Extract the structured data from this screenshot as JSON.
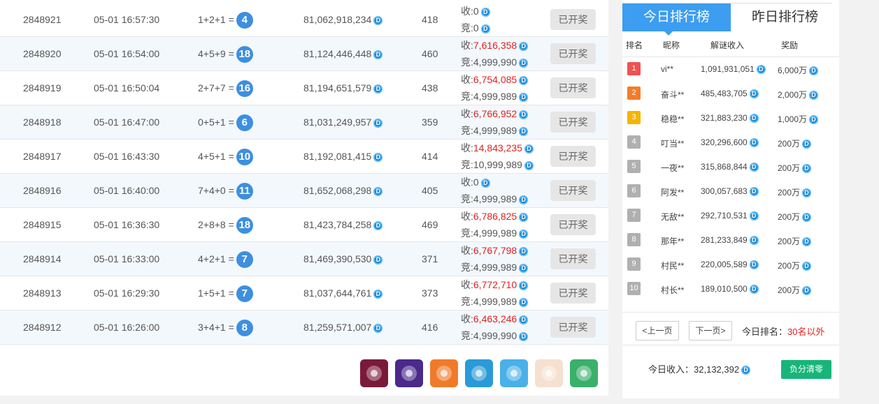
{
  "rows": [
    {
      "id": "2848921",
      "time": "05-01 16:57:30",
      "formula": "1+2+1 =",
      "sum": "4",
      "pool": "81,062,918,234",
      "count": "418",
      "income_label": "收:",
      "income": "0",
      "income_red": false,
      "bet_label": "竞:",
      "bet": "0",
      "status": "已开奖"
    },
    {
      "id": "2848920",
      "time": "05-01 16:54:00",
      "formula": "4+5+9 =",
      "sum": "18",
      "pool": "81,124,446,448",
      "count": "460",
      "income_label": "收:",
      "income": "7,616,358",
      "income_red": true,
      "bet_label": "竞:",
      "bet": "4,999,990",
      "status": "已开奖"
    },
    {
      "id": "2848919",
      "time": "05-01 16:50:04",
      "formula": "2+7+7 =",
      "sum": "16",
      "pool": "81,194,651,579",
      "count": "438",
      "income_label": "收:",
      "income": "6,754,085",
      "income_red": true,
      "bet_label": "竞:",
      "bet": "4,999,989",
      "status": "已开奖"
    },
    {
      "id": "2848918",
      "time": "05-01 16:47:00",
      "formula": "0+5+1 =",
      "sum": "6",
      "pool": "81,031,249,957",
      "count": "359",
      "income_label": "收:",
      "income": "6,766,952",
      "income_red": true,
      "bet_label": "竞:",
      "bet": "4,999,989",
      "status": "已开奖"
    },
    {
      "id": "2848917",
      "time": "05-01 16:43:30",
      "formula": "4+5+1 =",
      "sum": "10",
      "pool": "81,192,081,415",
      "count": "414",
      "income_label": "收:",
      "income": "14,843,235",
      "income_red": true,
      "bet_label": "竞:",
      "bet": "10,999,989",
      "status": "已开奖"
    },
    {
      "id": "2848916",
      "time": "05-01 16:40:00",
      "formula": "7+4+0 =",
      "sum": "11",
      "pool": "81,652,068,298",
      "count": "405",
      "income_label": "收:",
      "income": "0",
      "income_red": false,
      "bet_label": "竞:",
      "bet": "4,999,989",
      "status": "已开奖"
    },
    {
      "id": "2848915",
      "time": "05-01 16:36:30",
      "formula": "2+8+8 =",
      "sum": "18",
      "pool": "81,423,784,258",
      "count": "469",
      "income_label": "收:",
      "income": "6,786,825",
      "income_red": true,
      "bet_label": "竞:",
      "bet": "4,999,989",
      "status": "已开奖"
    },
    {
      "id": "2848914",
      "time": "05-01 16:33:00",
      "formula": "4+2+1 =",
      "sum": "7",
      "pool": "81,469,390,530",
      "count": "371",
      "income_label": "收:",
      "income": "6,767,798",
      "income_red": true,
      "bet_label": "竞:",
      "bet": "4,999,989",
      "status": "已开奖"
    },
    {
      "id": "2848913",
      "time": "05-01 16:29:30",
      "formula": "1+5+1 =",
      "sum": "7",
      "pool": "81,037,644,761",
      "count": "373",
      "income_label": "收:",
      "income": "6,772,710",
      "income_red": true,
      "bet_label": "竞:",
      "bet": "4,999,989",
      "status": "已开奖"
    },
    {
      "id": "2848912",
      "time": "05-01 16:26:00",
      "formula": "3+4+1 =",
      "sum": "8",
      "pool": "81,259,571,007",
      "count": "416",
      "income_label": "收:",
      "income": "6,463,246",
      "income_red": true,
      "bet_label": "竞:",
      "bet": "4,999,990",
      "status": "已开奖"
    }
  ],
  "coin_glyph": "D",
  "games": [
    {
      "name": "ufo-game-icon",
      "color": "#7a1a3a"
    },
    {
      "name": "rocket-game-icon",
      "color": "#4a2a8a"
    },
    {
      "name": "dragon-game-icon",
      "color": "#f07a2a"
    },
    {
      "name": "boat-game-icon",
      "color": "#2a9ad8"
    },
    {
      "name": "taxi-game-icon",
      "color": "#4ab0e8"
    },
    {
      "name": "scooter-game-icon",
      "color": "#f6e0d0"
    },
    {
      "name": "bicycle-game-icon",
      "color": "#3ab06a"
    }
  ],
  "sidebar": {
    "tab_today": "今日排行榜",
    "tab_yesterday": "昨日排行榜",
    "head_rank": "排名",
    "head_nick": "昵称",
    "head_income": "解谜收入",
    "head_reward": "奖励",
    "ranking": [
      {
        "rank": "1",
        "nick": "vi**",
        "income": "1,091,931,051",
        "reward": "6,000万",
        "color": "#ef5350"
      },
      {
        "rank": "2",
        "nick": "奋斗**",
        "income": "485,483,705",
        "reward": "2,000万",
        "color": "#f57c28"
      },
      {
        "rank": "3",
        "nick": "稳稳**",
        "income": "321,883,230",
        "reward": "1,000万",
        "color": "#f5b400"
      },
      {
        "rank": "4",
        "nick": "叮当**",
        "income": "320,296,600",
        "reward": "200万",
        "color": "#b0b0b0"
      },
      {
        "rank": "5",
        "nick": "一夜**",
        "income": "315,868,844",
        "reward": "200万",
        "color": "#b0b0b0"
      },
      {
        "rank": "6",
        "nick": "阿发**",
        "income": "300,057,683",
        "reward": "200万",
        "color": "#b0b0b0"
      },
      {
        "rank": "7",
        "nick": "无敌**",
        "income": "292,710,531",
        "reward": "200万",
        "color": "#b0b0b0"
      },
      {
        "rank": "8",
        "nick": "那年**",
        "income": "281,233,849",
        "reward": "200万",
        "color": "#b0b0b0"
      },
      {
        "rank": "9",
        "nick": "村民**",
        "income": "220,005,589",
        "reward": "200万",
        "color": "#b0b0b0"
      },
      {
        "rank": "10",
        "nick": "村长**",
        "income": "189,010,500",
        "reward": "200万",
        "color": "#b0b0b0"
      }
    ],
    "prev_page": "<上一页",
    "next_page": "下一页>",
    "today_rank_label": "今日排名：",
    "today_rank_value": "30名以外",
    "today_income_label": "今日收入：",
    "today_income_value": "32,132,392",
    "clear_button": "负分清零"
  }
}
